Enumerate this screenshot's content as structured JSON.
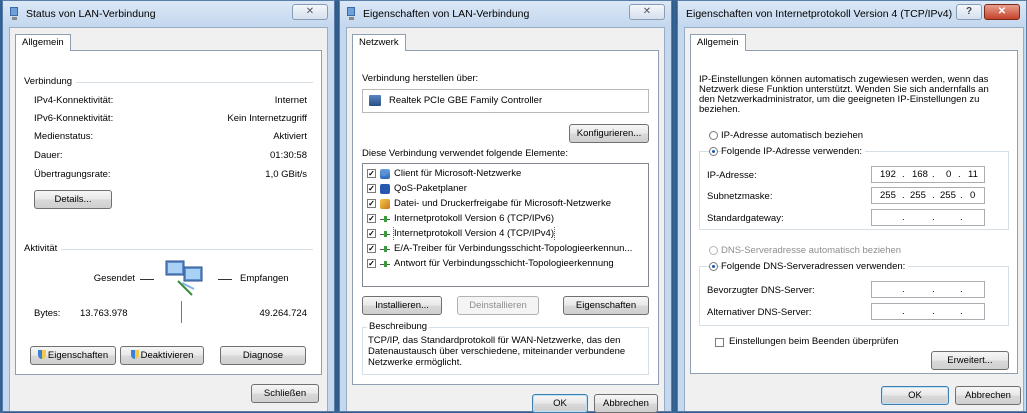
{
  "status_window": {
    "title": "Status von LAN-Verbindung",
    "close": "✕",
    "tab": "Allgemein",
    "connection": {
      "heading": "Verbindung",
      "rows": [
        {
          "label": "IPv4-Konnektivität:",
          "value": "Internet"
        },
        {
          "label": "IPv6-Konnektivität:",
          "value": "Kein Internetzugriff"
        },
        {
          "label": "Medienstatus:",
          "value": "Aktiviert"
        },
        {
          "label": "Dauer:",
          "value": "01:30:58"
        },
        {
          "label": "Übertragungsrate:",
          "value": "1,0 GBit/s"
        }
      ],
      "details_button": "Details..."
    },
    "activity": {
      "heading": "Aktivität",
      "sent": "Gesendet",
      "received": "Empfangen",
      "bytes_label": "Bytes:",
      "bytes_sent": "13.763.978",
      "bytes_received": "49.264.724"
    },
    "buttons": {
      "properties": "Eigenschaften",
      "deactivate": "Deaktivieren",
      "diagnose": "Diagnose"
    },
    "close_button": "Schließen"
  },
  "properties_window": {
    "title": "Eigenschaften von LAN-Verbindung",
    "close": "✕",
    "tab": "Netzwerk",
    "connect_via_label": "Verbindung herstellen über:",
    "adapter": "Realtek PCIe GBE Family Controller",
    "configure_button": "Konfigurieren...",
    "items_label": "Diese Verbindung verwendet folgende Elemente:",
    "items": [
      {
        "label": "Client für Microsoft-Netzwerke",
        "checked": true,
        "icon": "client-icon"
      },
      {
        "label": "QoS-Paketplaner",
        "checked": true,
        "icon": "qos-icon"
      },
      {
        "label": "Datei- und Druckerfreigabe für Microsoft-Netzwerke",
        "checked": true,
        "icon": "share-icon"
      },
      {
        "label": "Internetprotokoll Version 6 (TCP/IPv6)",
        "checked": true,
        "icon": "protocol-icon"
      },
      {
        "label": "Internetprotokoll Version 4 (TCP/IPv4)",
        "checked": true,
        "icon": "protocol-icon",
        "selected": true
      },
      {
        "label": "E/A-Treiber für Verbindungsschicht-Topologieerkennun...",
        "checked": true,
        "icon": "protocol-icon"
      },
      {
        "label": "Antwort für Verbindungsschicht-Topologieerkennung",
        "checked": true,
        "icon": "protocol-icon"
      }
    ],
    "install_button": "Installieren...",
    "uninstall_button": "Deinstallieren",
    "properties_button": "Eigenschaften",
    "description_heading": "Beschreibung",
    "description": "TCP/IP, das Standardprotokoll für WAN-Netzwerke, das den Datenaustausch über verschiedene, miteinander verbundene Netzwerke ermöglicht.",
    "ok_button": "OK",
    "cancel_button": "Abbrechen"
  },
  "ipv4_window": {
    "title": "Eigenschaften von Internetprotokoll Version 4 (TCP/IPv4)",
    "help": "?",
    "close": "✕",
    "tab": "Allgemein",
    "intro": "IP-Einstellungen können automatisch zugewiesen werden, wenn das Netzwerk diese Funktion unterstützt. Wenden Sie sich andernfalls an den Netzwerkadministrator, um die geeigneten IP-Einstellungen zu beziehen.",
    "radio_auto_ip": "IP-Adresse automatisch beziehen",
    "radio_manual_ip": "Folgende IP-Adresse verwenden:",
    "ip_label": "IP-Adresse:",
    "ip_value": [
      "192",
      "168",
      "0",
      "11"
    ],
    "subnet_label": "Subnetzmaske:",
    "subnet_value": [
      "255",
      "255",
      "255",
      "0"
    ],
    "gateway_label": "Standardgateway:",
    "radio_auto_dns": "DNS-Serveradresse automatisch beziehen",
    "radio_manual_dns": "Folgende DNS-Serveradressen verwenden:",
    "dns1_label": "Bevorzugter DNS-Server:",
    "dns2_label": "Alternativer DNS-Server:",
    "validate_label": "Einstellungen beim Beenden überprüfen",
    "advanced_button": "Erweitert...",
    "ok_button": "OK",
    "cancel_button": "Abbrechen"
  }
}
